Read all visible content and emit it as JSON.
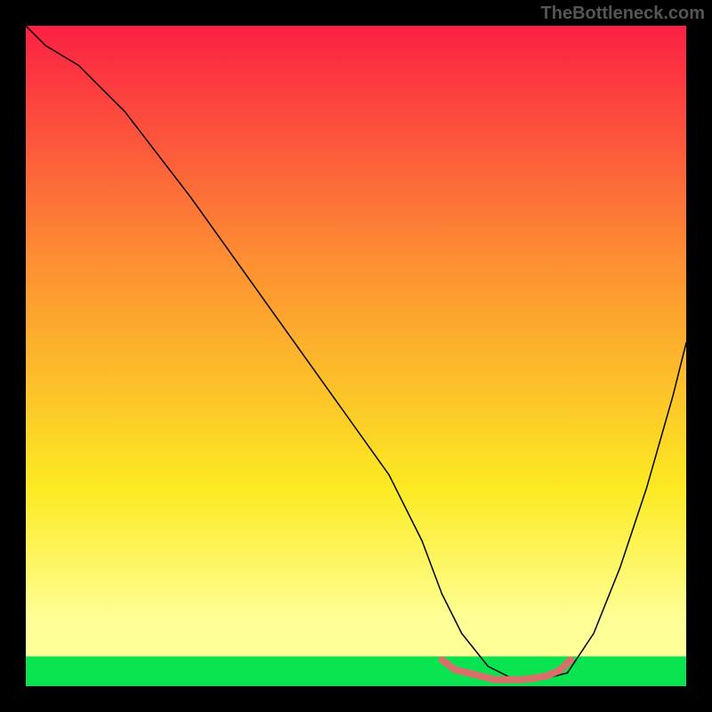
{
  "watermark": "TheBottleneck.com",
  "chart_data": {
    "type": "line",
    "title": "",
    "xlabel": "",
    "ylabel": "",
    "xlim": [
      0,
      100
    ],
    "ylim": [
      0,
      100
    ],
    "background_gradient": {
      "top": "#fb2044",
      "mid1": "#fd8d33",
      "mid2": "#fcea22",
      "mid3": "#feff97",
      "bottom": "#0ae350"
    },
    "green_band_top_y": 96,
    "series": [
      {
        "name": "bottleneck-curve",
        "color": "#000000",
        "width": 1.5,
        "x": [
          0,
          3,
          8,
          15,
          25,
          35,
          45,
          55,
          60,
          63,
          66,
          70,
          74,
          78,
          82,
          86,
          90,
          94,
          98,
          100
        ],
        "y": [
          100,
          97,
          94,
          87,
          74,
          60,
          46,
          32,
          22,
          14,
          8,
          3,
          1,
          1,
          2,
          8,
          18,
          30,
          44,
          52
        ]
      },
      {
        "name": "highlight-min-region",
        "color": "#d96f6a",
        "width": 8,
        "x": [
          63,
          65,
          67,
          69,
          71,
          73,
          75,
          77,
          79,
          81,
          82.5
        ],
        "y": [
          4,
          2.5,
          2,
          1.5,
          1,
          1,
          1,
          1.2,
          1.6,
          2.5,
          4
        ]
      }
    ]
  }
}
